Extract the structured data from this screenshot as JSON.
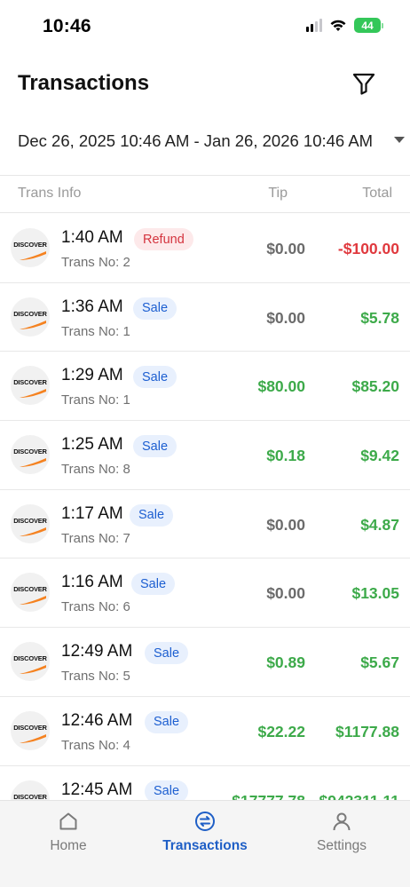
{
  "status_bar": {
    "time": "10:46",
    "battery": "44"
  },
  "header": {
    "title": "Transactions",
    "filter_icon": "filter-icon"
  },
  "date_range": {
    "value": "Dec 26, 2025 10:46 AM - Jan 26, 2026 10:46 AM"
  },
  "table": {
    "columns": [
      "Trans Info",
      "Tip",
      "Total"
    ],
    "card_brand": "DISCOVER",
    "rows": [
      {
        "time": "1:40 AM",
        "type": "Refund",
        "trans_no": "Trans No: 2",
        "tip": "$0.00",
        "total": "-$100.00",
        "tip_style": "neutral",
        "total_style": "red"
      },
      {
        "time": "1:36 AM",
        "type": "Sale",
        "trans_no": "Trans No: 1",
        "tip": "$0.00",
        "total": "$5.78",
        "tip_style": "neutral",
        "total_style": "green"
      },
      {
        "time": "1:29 AM",
        "type": "Sale",
        "trans_no": "Trans No: 1",
        "tip": "$80.00",
        "total": "$85.20",
        "tip_style": "green",
        "total_style": "green"
      },
      {
        "time": "1:25 AM",
        "type": "Sale",
        "trans_no": "Trans No: 8",
        "tip": "$0.18",
        "total": "$9.42",
        "tip_style": "green",
        "total_style": "green"
      },
      {
        "time": "1:17 AM",
        "type": "Sale",
        "trans_no": "Trans No: 7",
        "tip": "$0.00",
        "total": "$4.87",
        "tip_style": "neutral",
        "total_style": "green"
      },
      {
        "time": "1:16 AM",
        "type": "Sale",
        "trans_no": "Trans No: 6",
        "tip": "$0.00",
        "total": "$13.05",
        "tip_style": "neutral",
        "total_style": "green"
      },
      {
        "time": "12:49 AM",
        "type": "Sale",
        "trans_no": "Trans No: 5",
        "tip": "$0.89",
        "total": "$5.67",
        "tip_style": "green",
        "total_style": "green"
      },
      {
        "time": "12:46 AM",
        "type": "Sale",
        "trans_no": "Trans No: 4",
        "tip": "$22.22",
        "total": "$1177.88",
        "tip_style": "green",
        "total_style": "green"
      },
      {
        "time": "12:45 AM",
        "type": "Sale",
        "trans_no": "",
        "tip": "$17777.78",
        "total": "$942311.11",
        "tip_style": "green",
        "total_style": "green"
      }
    ]
  },
  "bottom_nav": {
    "items": [
      {
        "label": "Home",
        "icon": "home-icon",
        "active": false
      },
      {
        "label": "Transactions",
        "icon": "transactions-icon",
        "active": true
      },
      {
        "label": "Settings",
        "icon": "person-icon",
        "active": false
      }
    ]
  },
  "colors": {
    "accent": "#1f5fc6",
    "positive": "#3daa4a",
    "negative": "#e0393e",
    "sale_badge_bg": "#e8f0fd",
    "refund_badge_bg": "#fde9ea",
    "discover_orange": "#f58220"
  }
}
